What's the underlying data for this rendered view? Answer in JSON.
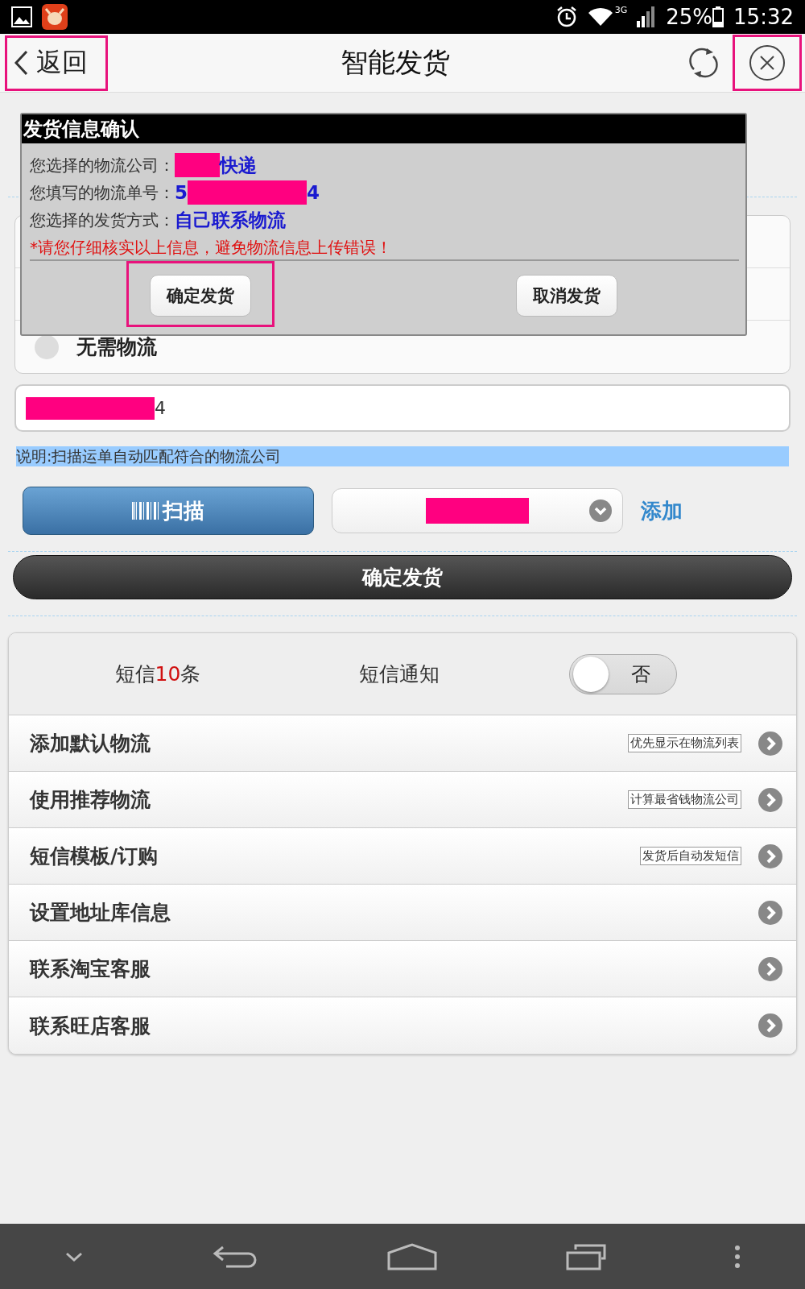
{
  "status_bar": {
    "network": "3G",
    "battery": "25%",
    "time": "15:32"
  },
  "header": {
    "back": {
      "label": "返回",
      "highlighted": true
    },
    "title": "智能发货",
    "close": {
      "highlighted": true
    }
  },
  "logistics_options": [
    {
      "label": "无需物流",
      "selected": false
    }
  ],
  "tracking_field": {
    "value": "4"
  },
  "note": "说明:扫描运单自动匹配符合的物流公司",
  "scan_button": "扫描",
  "add_link": "添加",
  "confirm_button": "确定发货",
  "sms": {
    "prefix": "短信",
    "count": "10",
    "suffix": "条",
    "notify_label": "短信通知",
    "toggle": {
      "on": false,
      "label": "否"
    }
  },
  "menu": [
    {
      "label": "添加默认物流",
      "tag": "优先显示在物流列表"
    },
    {
      "label": "使用推荐物流",
      "tag": "计算最省钱物流公司"
    },
    {
      "label": "短信模板/订购",
      "tag": "发货后自动发短信"
    },
    {
      "label": "设置地址库信息"
    },
    {
      "label": "联系淘宝客服"
    },
    {
      "label": "联系旺店客服"
    }
  ],
  "dialog": {
    "title": "发货信息确认",
    "rows": [
      {
        "label": "您选择的物流公司：",
        "segments": [
          {
            "kind": "redaction"
          },
          {
            "kind": "text",
            "text": "快递"
          }
        ]
      },
      {
        "label": "您填写的物流单号：",
        "segments": [
          {
            "kind": "text",
            "text": "5"
          },
          {
            "kind": "redaction"
          },
          {
            "kind": "text",
            "text": "4"
          }
        ]
      },
      {
        "label": "您选择的发货方式：",
        "segments": [
          {
            "kind": "text",
            "text": "自己联系物流"
          }
        ]
      }
    ],
    "warning": "*请您仔细核实以上信息，避免物流信息上传错误！",
    "buttons": [
      {
        "label": "确定发货",
        "highlighted": true
      },
      {
        "label": "取消发货",
        "highlighted": false
      }
    ]
  }
}
